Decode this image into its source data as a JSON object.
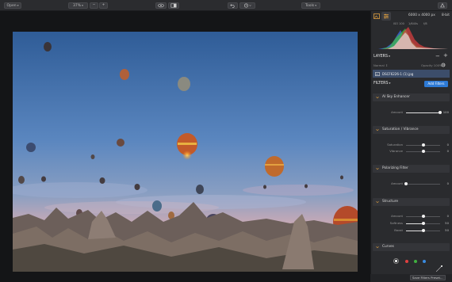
{
  "toolbar": {
    "open_label": "Open",
    "zoom_label": "37%",
    "minus_label": "−",
    "plus_label": "+",
    "tools_label": "Tools"
  },
  "histogram_info": {
    "dimensions": "6000 x 4000 px",
    "bit_depth": "8-bit",
    "iso": "ISO 100",
    "shutter": "1/640s",
    "aperture": "f/8"
  },
  "layers": {
    "title": "LAYERS",
    "blend_mode": "Normal",
    "opacity_label": "Opacity 100%",
    "file_name": "DSCF6226-1 (1).jpg"
  },
  "filters": {
    "title": "FILTERS",
    "add_button": "Add Filters",
    "save_preset": "Save Filters Preset...",
    "sections": [
      {
        "name": "AI Sky Enhancer",
        "rows": [
          {
            "label": "Amount",
            "value": "100",
            "fraction": 1.0
          }
        ]
      },
      {
        "name": "Saturation / Vibrance",
        "rows": [
          {
            "label": "Saturation",
            "value": "0",
            "fraction": 0.5
          },
          {
            "label": "Vibrance",
            "value": "0",
            "fraction": 0.5
          }
        ]
      },
      {
        "name": "Polarizing Filter",
        "rows": [
          {
            "label": "Amount",
            "value": "0",
            "fraction": 0.0
          }
        ]
      },
      {
        "name": "Structure",
        "rows": [
          {
            "label": "Amount",
            "value": "0",
            "fraction": 0.5
          },
          {
            "label": "Softness",
            "value": "50",
            "fraction": 0.5
          },
          {
            "label": "Boost",
            "value": "50",
            "fraction": 0.5
          }
        ]
      },
      {
        "name": "Curves",
        "rows": []
      }
    ]
  },
  "colors": {
    "accent_blue": "#2d7ad6",
    "curve_white": "#ffffff",
    "curve_red": "#e04040",
    "curve_green": "#40b040",
    "curve_blue": "#3a8be0"
  }
}
